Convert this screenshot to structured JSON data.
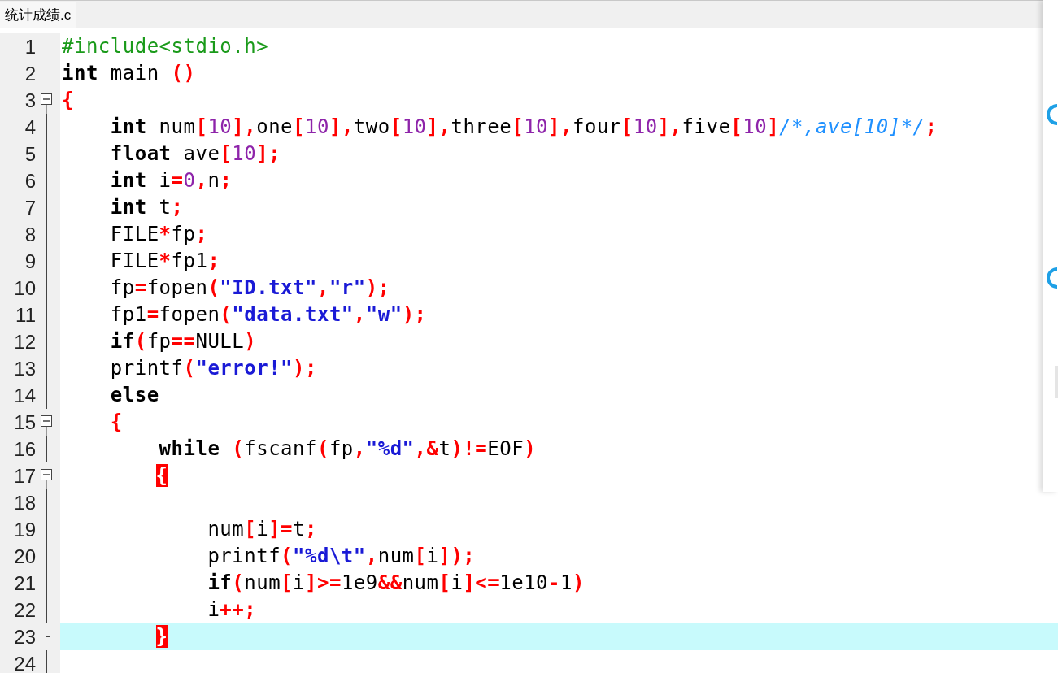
{
  "tabs": [
    {
      "label": "统计成绩.c",
      "selected": true
    }
  ],
  "lines": [
    {
      "number": "1",
      "kind": "plain",
      "current": false,
      "tokens": [
        {
          "kind": "preproc",
          "text": "#include<stdio.h>"
        }
      ]
    },
    {
      "number": "2",
      "kind": "plain",
      "current": false,
      "tokens": [
        {
          "kind": "keyword",
          "text": "int"
        },
        {
          "kind": "plain",
          "text": " main "
        },
        {
          "kind": "op",
          "text": "()"
        }
      ]
    },
    {
      "number": "3",
      "kind": "fold-start",
      "current": false,
      "tokens": [
        {
          "kind": "op",
          "text": "{"
        }
      ]
    },
    {
      "number": "4",
      "kind": "fold-body",
      "current": false,
      "tokens": [
        {
          "kind": "keyword",
          "text": "    int"
        },
        {
          "kind": "plain",
          "text": " num"
        },
        {
          "kind": "op",
          "text": "["
        },
        {
          "kind": "number",
          "text": "10"
        },
        {
          "kind": "op",
          "text": "],"
        },
        {
          "kind": "plain",
          "text": "one"
        },
        {
          "kind": "op",
          "text": "["
        },
        {
          "kind": "number",
          "text": "10"
        },
        {
          "kind": "op",
          "text": "],"
        },
        {
          "kind": "plain",
          "text": "two"
        },
        {
          "kind": "op",
          "text": "["
        },
        {
          "kind": "number",
          "text": "10"
        },
        {
          "kind": "op",
          "text": "],"
        },
        {
          "kind": "plain",
          "text": "three"
        },
        {
          "kind": "op",
          "text": "["
        },
        {
          "kind": "number",
          "text": "10"
        },
        {
          "kind": "op",
          "text": "],"
        },
        {
          "kind": "plain",
          "text": "four"
        },
        {
          "kind": "op",
          "text": "["
        },
        {
          "kind": "number",
          "text": "10"
        },
        {
          "kind": "op",
          "text": "],"
        },
        {
          "kind": "plain",
          "text": "five"
        },
        {
          "kind": "op",
          "text": "["
        },
        {
          "kind": "number",
          "text": "10"
        },
        {
          "kind": "op",
          "text": "]"
        },
        {
          "kind": "comment",
          "text": "/*,ave[10]*/"
        },
        {
          "kind": "op",
          "text": ";"
        }
      ]
    },
    {
      "number": "5",
      "kind": "fold-body",
      "current": false,
      "tokens": [
        {
          "kind": "keyword",
          "text": "    float"
        },
        {
          "kind": "plain",
          "text": " ave"
        },
        {
          "kind": "op",
          "text": "["
        },
        {
          "kind": "number",
          "text": "10"
        },
        {
          "kind": "op",
          "text": "];"
        }
      ]
    },
    {
      "number": "6",
      "kind": "fold-body",
      "current": false,
      "tokens": [
        {
          "kind": "keyword",
          "text": "    int"
        },
        {
          "kind": "plain",
          "text": " i"
        },
        {
          "kind": "op",
          "text": "="
        },
        {
          "kind": "number",
          "text": "0"
        },
        {
          "kind": "op",
          "text": ","
        },
        {
          "kind": "plain",
          "text": "n"
        },
        {
          "kind": "op",
          "text": ";"
        }
      ]
    },
    {
      "number": "7",
      "kind": "fold-body",
      "current": false,
      "tokens": [
        {
          "kind": "keyword",
          "text": "    int"
        },
        {
          "kind": "plain",
          "text": " t"
        },
        {
          "kind": "op",
          "text": ";"
        }
      ]
    },
    {
      "number": "8",
      "kind": "fold-body",
      "current": false,
      "tokens": [
        {
          "kind": "plain",
          "text": "    FILE"
        },
        {
          "kind": "op",
          "text": "*"
        },
        {
          "kind": "plain",
          "text": "fp"
        },
        {
          "kind": "op",
          "text": ";"
        }
      ]
    },
    {
      "number": "9",
      "kind": "fold-body",
      "current": false,
      "tokens": [
        {
          "kind": "plain",
          "text": "    FILE"
        },
        {
          "kind": "op",
          "text": "*"
        },
        {
          "kind": "plain",
          "text": "fp1"
        },
        {
          "kind": "op",
          "text": ";"
        }
      ]
    },
    {
      "number": "10",
      "kind": "fold-body",
      "current": false,
      "tokens": [
        {
          "kind": "plain",
          "text": "    fp"
        },
        {
          "kind": "op",
          "text": "="
        },
        {
          "kind": "plain",
          "text": "fopen"
        },
        {
          "kind": "op",
          "text": "("
        },
        {
          "kind": "string",
          "text": "\"ID.txt\""
        },
        {
          "kind": "op",
          "text": ","
        },
        {
          "kind": "string",
          "text": "\"r\""
        },
        {
          "kind": "op",
          "text": ");"
        }
      ]
    },
    {
      "number": "11",
      "kind": "fold-body",
      "current": false,
      "tokens": [
        {
          "kind": "plain",
          "text": "    fp1"
        },
        {
          "kind": "op",
          "text": "="
        },
        {
          "kind": "plain",
          "text": "fopen"
        },
        {
          "kind": "op",
          "text": "("
        },
        {
          "kind": "string",
          "text": "\"data.txt\""
        },
        {
          "kind": "op",
          "text": ","
        },
        {
          "kind": "string",
          "text": "\"w\""
        },
        {
          "kind": "op",
          "text": ");"
        }
      ]
    },
    {
      "number": "12",
      "kind": "fold-body",
      "current": false,
      "tokens": [
        {
          "kind": "keyword",
          "text": "    if"
        },
        {
          "kind": "op",
          "text": "("
        },
        {
          "kind": "plain",
          "text": "fp"
        },
        {
          "kind": "op",
          "text": "=="
        },
        {
          "kind": "plain",
          "text": "NULL"
        },
        {
          "kind": "op",
          "text": ")"
        }
      ]
    },
    {
      "number": "13",
      "kind": "fold-body",
      "current": false,
      "tokens": [
        {
          "kind": "plain",
          "text": "    printf"
        },
        {
          "kind": "op",
          "text": "("
        },
        {
          "kind": "string",
          "text": "\"error!\""
        },
        {
          "kind": "op",
          "text": ");"
        }
      ]
    },
    {
      "number": "14",
      "kind": "fold-body",
      "current": false,
      "tokens": [
        {
          "kind": "keyword",
          "text": "    else"
        }
      ]
    },
    {
      "number": "15",
      "kind": "fold-start",
      "current": false,
      "tokens": [
        {
          "kind": "op",
          "text": "    {"
        }
      ]
    },
    {
      "number": "16",
      "kind": "fold-body",
      "current": false,
      "tokens": [
        {
          "kind": "keyword",
          "text": "        while"
        },
        {
          "kind": "op",
          "text": " ("
        },
        {
          "kind": "plain",
          "text": "fscanf"
        },
        {
          "kind": "op",
          "text": "("
        },
        {
          "kind": "plain",
          "text": "fp"
        },
        {
          "kind": "op",
          "text": ","
        },
        {
          "kind": "string",
          "text": "\"%d\""
        },
        {
          "kind": "op",
          "text": ",&"
        },
        {
          "kind": "plain",
          "text": "t"
        },
        {
          "kind": "op",
          "text": ")!="
        },
        {
          "kind": "plain",
          "text": "EOF"
        },
        {
          "kind": "op",
          "text": ")"
        }
      ]
    },
    {
      "number": "17",
      "kind": "fold-start",
      "current": false,
      "tokens": [
        {
          "kind": "match",
          "text": "{"
        }
      ]
    },
    {
      "number": "18",
      "kind": "fold-body",
      "current": false
    },
    {
      "number": "19",
      "kind": "fold-body",
      "current": false,
      "tokens": [
        {
          "kind": "plain",
          "text": "            num"
        },
        {
          "kind": "op",
          "text": "["
        },
        {
          "kind": "plain",
          "text": "i"
        },
        {
          "kind": "op",
          "text": "]="
        },
        {
          "kind": "plain",
          "text": "t"
        },
        {
          "kind": "op",
          "text": ";"
        }
      ]
    },
    {
      "number": "20",
      "kind": "fold-body",
      "current": false,
      "tokens": [
        {
          "kind": "plain",
          "text": "            printf"
        },
        {
          "kind": "op",
          "text": "("
        },
        {
          "kind": "string",
          "text": "\"%d\\t\""
        },
        {
          "kind": "op",
          "text": ","
        },
        {
          "kind": "plain",
          "text": "num"
        },
        {
          "kind": "op",
          "text": "["
        },
        {
          "kind": "plain",
          "text": "i"
        },
        {
          "kind": "op",
          "text": "]);"
        }
      ]
    },
    {
      "number": "21",
      "kind": "fold-body",
      "current": false,
      "tokens": [
        {
          "kind": "keyword",
          "text": "            if"
        },
        {
          "kind": "op",
          "text": "("
        },
        {
          "kind": "plain",
          "text": "num"
        },
        {
          "kind": "op",
          "text": "["
        },
        {
          "kind": "plain",
          "text": "i"
        },
        {
          "kind": "op",
          "text": "]>="
        },
        {
          "kind": "plain",
          "text": "1e9"
        },
        {
          "kind": "op",
          "text": "&&"
        },
        {
          "kind": "plain",
          "text": "num"
        },
        {
          "kind": "op",
          "text": "["
        },
        {
          "kind": "plain",
          "text": "i"
        },
        {
          "kind": "op",
          "text": "]<="
        },
        {
          "kind": "plain",
          "text": "1e10"
        },
        {
          "kind": "op",
          "text": "-"
        },
        {
          "kind": "plain",
          "text": "1"
        },
        {
          "kind": "op",
          "text": ")"
        }
      ]
    },
    {
      "number": "22",
      "kind": "fold-body",
      "current": false,
      "tokens": [
        {
          "kind": "plain",
          "text": "            i"
        },
        {
          "kind": "op",
          "text": "++;"
        }
      ]
    },
    {
      "number": "23",
      "kind": "fold-end",
      "current": true,
      "tokens": [
        {
          "kind": "match",
          "text": "}"
        }
      ]
    },
    {
      "number": "24",
      "kind": "fold-body",
      "current": false
    }
  ]
}
